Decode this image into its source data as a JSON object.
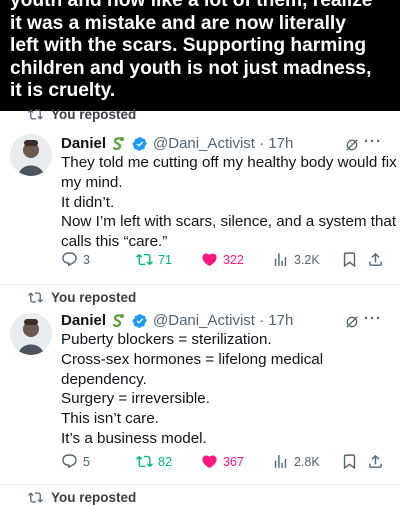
{
  "banner": {
    "lines": [
      "youth and now like a lot of them, realize",
      "it was a mistake and are now literally",
      "left with the scars. Supporting harming",
      "children and youth is not just madness,",
      "it is cruelty."
    ]
  },
  "posts": [
    {
      "reposted_label": "You reposted",
      "author_name": "Daniel",
      "handle_time": "@Dani_Activist · 17h",
      "text_lines": [
        "They told me cutting off my healthy body would fix",
        "my mind.",
        "It didn’t.",
        "Now I’m left with scars, silence, and a system that",
        "calls this “care.”"
      ],
      "replies": "3",
      "reposts": "71",
      "likes": "322",
      "views": "3.2K"
    },
    {
      "reposted_label": "You reposted",
      "author_name": "Daniel",
      "handle_time": "@Dani_Activist · 17h",
      "text_lines": [
        "Puberty blockers = sterilization.",
        "Cross-sex hormones = lifelong medical",
        "dependency.",
        "Surgery = irreversible.",
        "This isn’t care.",
        "It’s a business model."
      ],
      "replies": "5",
      "reposts": "82",
      "likes": "367",
      "views": "2.8K"
    }
  ],
  "next_repost_label": "You reposted",
  "icons": [
    "repost-icon",
    "verified-icon",
    "snake-emoji-icon",
    "grok-icon",
    "more-icon",
    "reply-icon",
    "like-icon",
    "views-icon",
    "bookmark-icon",
    "share-icon"
  ],
  "colors": {
    "verified": "#1d9bf0",
    "repost": "#00ba7c",
    "like": "#f91880",
    "muted": "#536471"
  }
}
